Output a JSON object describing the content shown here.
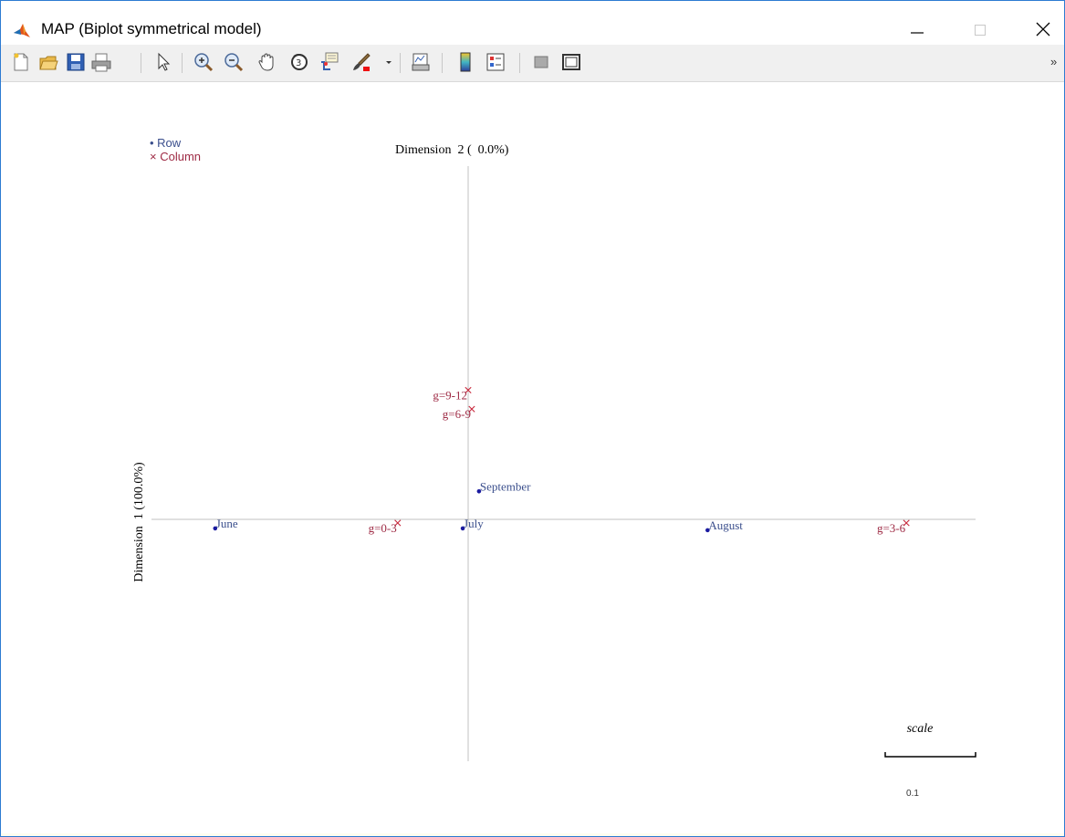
{
  "window": {
    "title": "MAP (Biplot symmetrical model)",
    "controls": {
      "minimize": "minimize",
      "maximize": "maximize",
      "close": "close"
    }
  },
  "toolbar": {
    "items": [
      "new-figure-icon",
      "open-file-icon",
      "save-icon",
      "print-icon",
      "pointer-icon",
      "zoom-in-icon",
      "zoom-out-icon",
      "pan-hand-icon",
      "rotate-3d-icon",
      "data-cursor-icon",
      "brush-icon",
      "brush-dropdown-icon",
      "link-plot-icon",
      "insert-colorbar-icon",
      "insert-legend-icon",
      "hide-plot-tools-icon",
      "show-plot-tools-icon"
    ],
    "overflow": "»"
  },
  "colors": {
    "row": "#3a4e8c",
    "row_marker": "#1a1aa0",
    "column": "#9e2a44",
    "column_marker": "#c8283c",
    "axis": "#c0c0c0",
    "title_accent": "#2d7bd2"
  },
  "chart_data": {
    "type": "scatter",
    "xlabel": "Dimension  1 (100.0%)",
    "ylabel": "Dimension  2 (  0.0%)",
    "legend": {
      "placement": "top-left",
      "row": "• Row",
      "column": "× Column"
    },
    "series": [
      {
        "name": "Row",
        "marker": "dot",
        "points": [
          {
            "label": "June",
            "x": -0.28,
            "y": -0.01
          },
          {
            "label": "July",
            "x": -0.006,
            "y": -0.01
          },
          {
            "label": "August",
            "x": 0.265,
            "y": -0.012
          },
          {
            "label": "September",
            "x": 0.012,
            "y": 0.031
          }
        ]
      },
      {
        "name": "Column",
        "marker": "cross",
        "points": [
          {
            "label": "g=0-3",
            "x": -0.078,
            "y": -0.004
          },
          {
            "label": "g=3-6",
            "x": 0.485,
            "y": -0.004
          },
          {
            "label": "g=6-9",
            "x": 0.004,
            "y": 0.122
          },
          {
            "label": "g=9-12",
            "x": 0.0,
            "y": 0.143
          }
        ]
      }
    ],
    "scale_bar": {
      "label": "scale",
      "value": "0.1",
      "length": 0.1
    },
    "grid": false
  }
}
